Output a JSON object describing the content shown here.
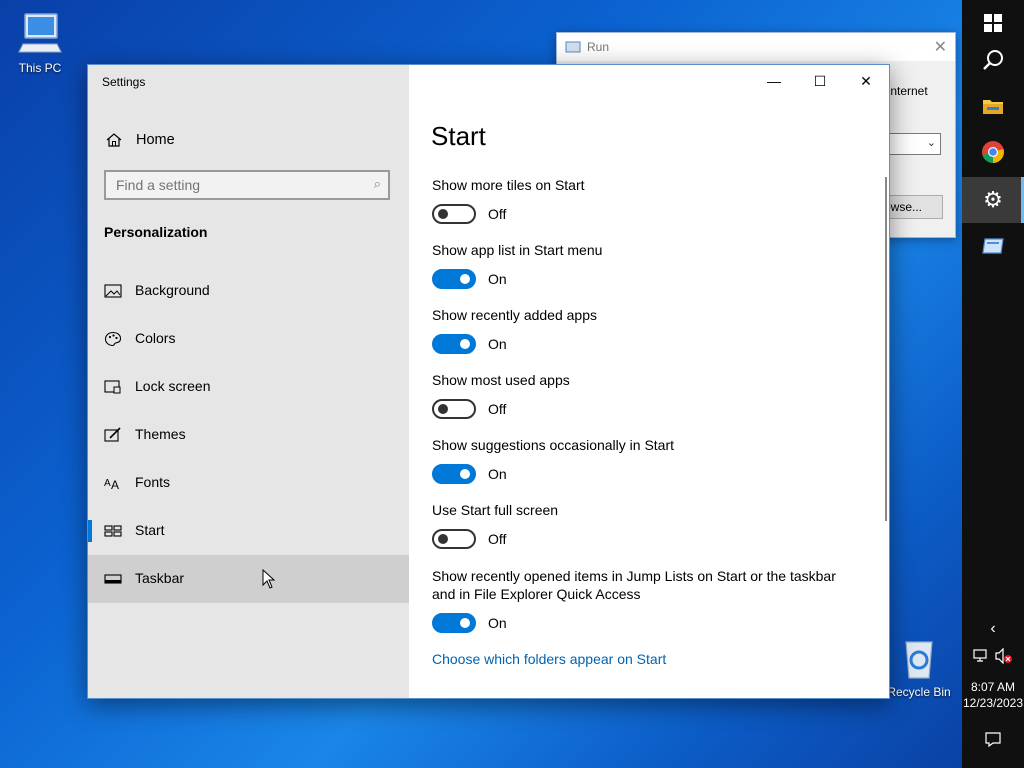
{
  "desktop": {
    "this_pc_label": "This PC",
    "recycle_bin_label": "Recycle Bin"
  },
  "run_dialog": {
    "title": "Run",
    "partial_text": "Internet",
    "browse_label": "Browse..."
  },
  "settings": {
    "window_title": "Settings",
    "home_label": "Home",
    "search_placeholder": "Find a setting",
    "section": "Personalization",
    "nav": [
      {
        "label": "Background",
        "icon": "picture-icon"
      },
      {
        "label": "Colors",
        "icon": "palette-icon"
      },
      {
        "label": "Lock screen",
        "icon": "lock-screen-icon"
      },
      {
        "label": "Themes",
        "icon": "themes-brush-icon"
      },
      {
        "label": "Fonts",
        "icon": "fonts-icon"
      },
      {
        "label": "Start",
        "icon": "start-icon",
        "selected": true
      },
      {
        "label": "Taskbar",
        "icon": "taskbar-icon",
        "hovered": true
      }
    ],
    "page_title": "Start",
    "toggles": [
      {
        "label": "Show more tiles on Start",
        "state": "Off"
      },
      {
        "label": "Show app list in Start menu",
        "state": "On"
      },
      {
        "label": "Show recently added apps",
        "state": "On"
      },
      {
        "label": "Show most used apps",
        "state": "Off"
      },
      {
        "label": "Show suggestions occasionally in Start",
        "state": "On"
      },
      {
        "label": "Use Start full screen",
        "state": "Off"
      },
      {
        "label": "Show recently opened items in Jump Lists on Start or the taskbar and in File Explorer Quick Access",
        "state": "On"
      }
    ],
    "link": "Choose which folders appear on Start",
    "accent_color": "#0078d7"
  },
  "taskbar": {
    "time": "8:07 AM",
    "date": "12/23/2023",
    "apps": [
      "windows-start-icon",
      "search-icon",
      "file-explorer-icon",
      "chrome-icon",
      "settings-gear-icon",
      "run-app-icon"
    ]
  }
}
